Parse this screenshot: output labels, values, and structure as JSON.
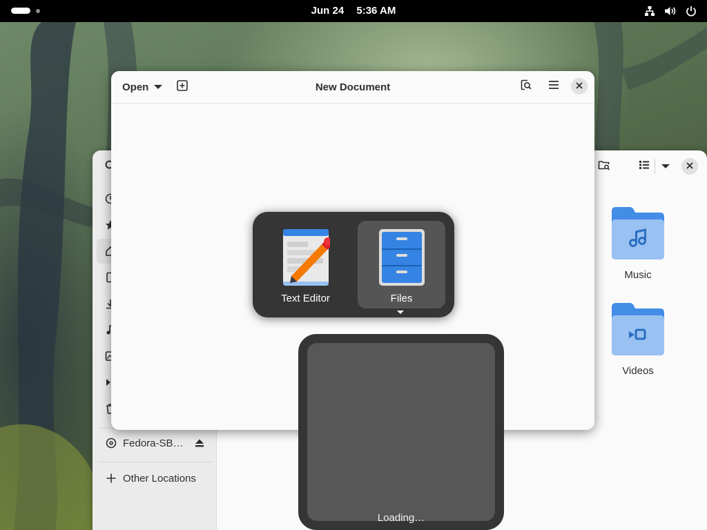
{
  "topbar": {
    "date": "Jun 24",
    "time": "5:36 AM",
    "icons": [
      "network-wired-icon",
      "volume-icon",
      "power-icon"
    ]
  },
  "editor": {
    "open_label": "Open",
    "title": "New Document",
    "icons": [
      "open-dropdown-icon",
      "new-tab-icon",
      "find-icon",
      "menu-icon",
      "close-icon"
    ]
  },
  "files": {
    "sidebar": {
      "drive_label": "Fedora-SB…",
      "other_locations_label": "Other Locations"
    },
    "folders": [
      {
        "name": "Music",
        "icon": "music-note-icon"
      },
      {
        "name": "Videos",
        "icon": "video-icon"
      }
    ]
  },
  "switcher": {
    "apps": [
      {
        "label": "Text Editor",
        "icon": "text-editor-icon",
        "selected": false
      },
      {
        "label": "Files",
        "icon": "files-cabinet-icon",
        "selected": true
      }
    ]
  },
  "preview": {
    "loading_label": "Loading…"
  },
  "colors": {
    "folder_blue": "#438de6",
    "folder_light": "#99c1f1",
    "switcher_bg": "#353535",
    "topbar_bg": "#000000"
  }
}
